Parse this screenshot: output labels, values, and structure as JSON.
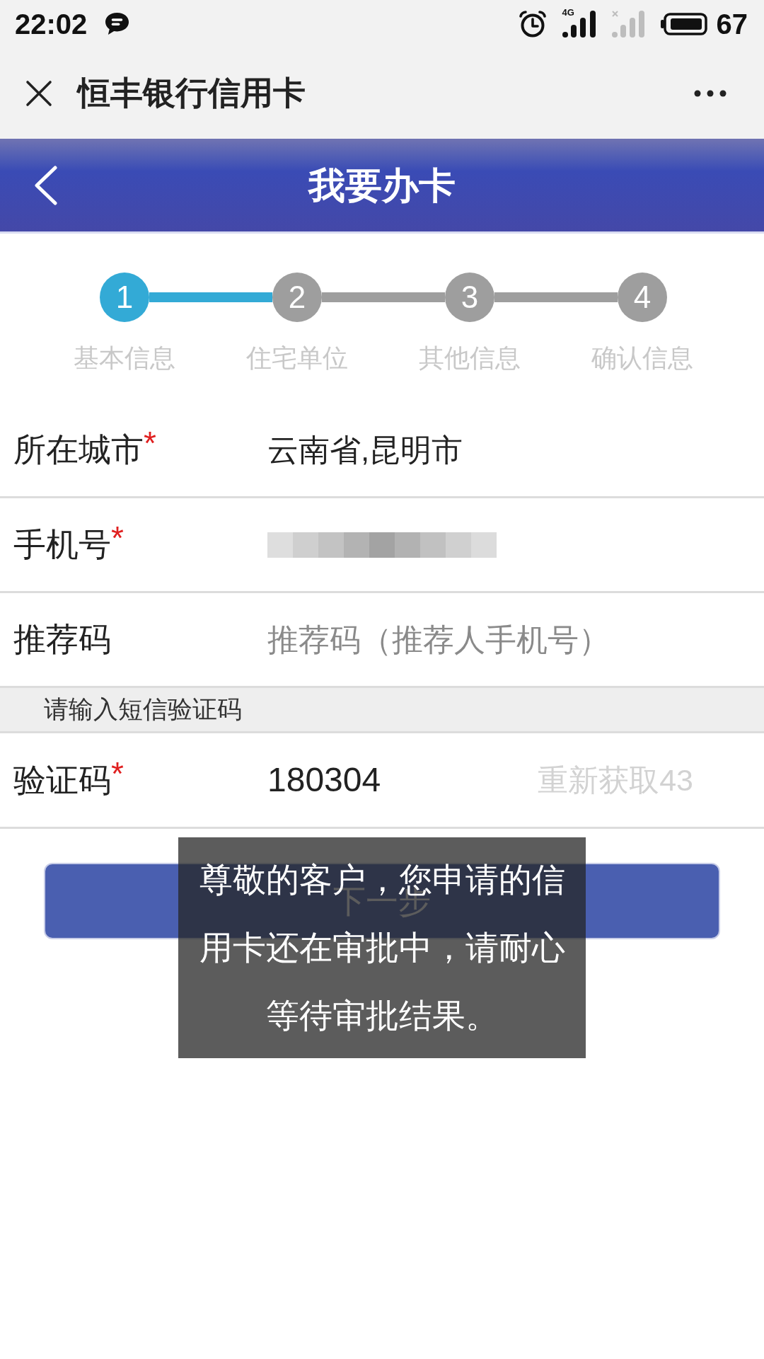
{
  "status_bar": {
    "time": "22:02",
    "network": "4G",
    "battery": "67"
  },
  "title_bar": {
    "title": "恒丰银行信用卡"
  },
  "header": {
    "title": "我要办卡"
  },
  "steps": [
    {
      "number": "1",
      "label": "基本信息",
      "selected": true
    },
    {
      "number": "2",
      "label": "住宅单位",
      "selected": false
    },
    {
      "number": "3",
      "label": "其他信息",
      "selected": false
    },
    {
      "number": "4",
      "label": "确认信息",
      "selected": false
    }
  ],
  "form": [
    {
      "kind": "field",
      "label": "所在城市",
      "mark": "*",
      "value": "云南省,昆明市"
    },
    {
      "kind": "redacted",
      "label": "手机号",
      "mark": "*"
    },
    {
      "kind": "field",
      "label": "推荐码",
      "placeholder": "推荐码（推荐人手机号）"
    },
    {
      "kind": "section",
      "text": "请输入短信验证码"
    },
    {
      "kind": "code",
      "label": "验证码",
      "mark": "*",
      "value": "180304",
      "action": {
        "label": "重新获取43",
        "disabled": true
      }
    }
  ],
  "next_button": {
    "label": "下一步"
  },
  "toast": {
    "message": "尊敬的客户，您申请的信用卡还在审批中，请耐心等待审批结果。"
  }
}
